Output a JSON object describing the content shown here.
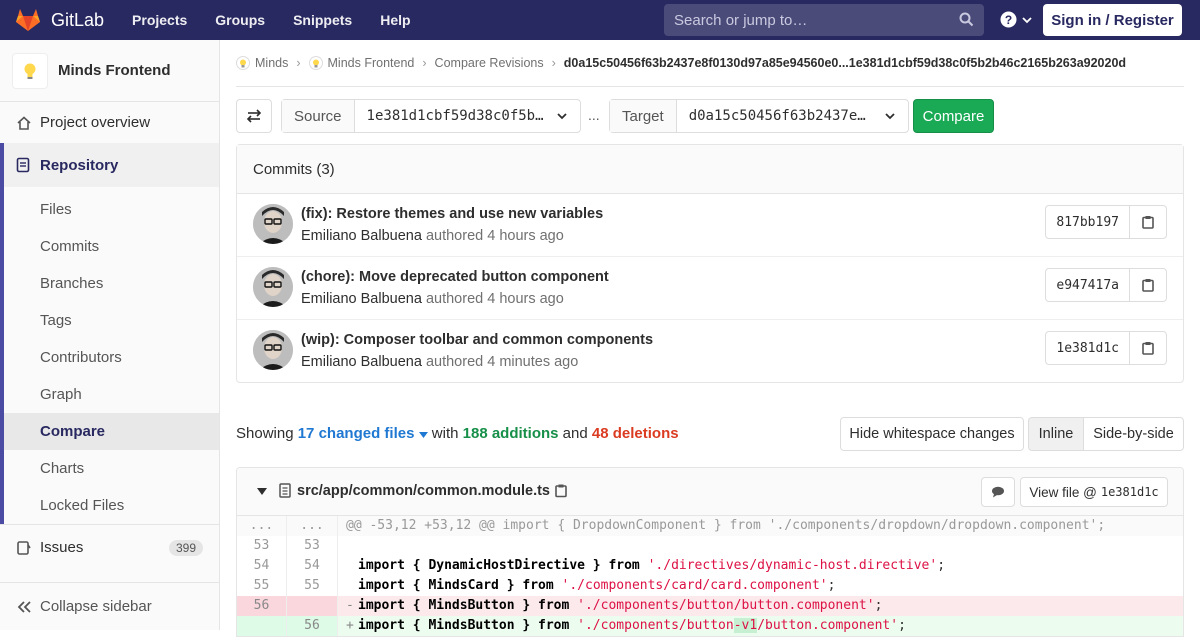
{
  "colors": {
    "nav_bg": "#292961",
    "accent_green": "#1aaa55",
    "link_blue": "#1f78d1",
    "add_green": "#168f48",
    "del_red": "#db3b21"
  },
  "header": {
    "brand": "GitLab",
    "nav": [
      "Projects",
      "Groups",
      "Snippets",
      "Help"
    ],
    "search_placeholder": "Search or jump to…",
    "signin": "Sign in / Register"
  },
  "sidebar": {
    "project_name": "Minds Frontend",
    "overview": "Project overview",
    "repository": "Repository",
    "sub_items": [
      "Files",
      "Commits",
      "Branches",
      "Tags",
      "Contributors",
      "Graph",
      "Compare",
      "Charts",
      "Locked Files"
    ],
    "issues": "Issues",
    "issues_count": "399",
    "collapse": "Collapse sidebar"
  },
  "breadcrumb": {
    "items": [
      "Minds",
      "Minds Frontend",
      "Compare Revisions"
    ],
    "current": "d0a15c50456f63b2437e8f0130d97a85e94560e0...1e381d1cbf59d38c0f5b2b46c2165b263a92020d"
  },
  "compare": {
    "source_label": "Source",
    "source_value": "1e381d1cbf59d38c0f5b…",
    "dots": "...",
    "target_label": "Target",
    "target_value": "d0a15c50456f63b2437e…",
    "button": "Compare"
  },
  "commits": {
    "header": "Commits (3)",
    "items": [
      {
        "title": "(fix): Restore themes and use new variables",
        "author": "Emiliano Balbuena",
        "authored": "authored 4 hours ago",
        "sha": "817bb197"
      },
      {
        "title": "(chore): Move deprecated button component",
        "author": "Emiliano Balbuena",
        "authored": "authored 4 hours ago",
        "sha": "e947417a"
      },
      {
        "title": "(wip): Composer toolbar and common components",
        "author": "Emiliano Balbuena",
        "authored": "authored 4 minutes ago",
        "sha": "1e381d1c"
      }
    ]
  },
  "summary": {
    "showing": "Showing",
    "changed": "17 changed files",
    "with": "with",
    "additions": "188 additions",
    "and": "and",
    "deletions": "48 deletions",
    "whitespace": "Hide whitespace changes",
    "inline": "Inline",
    "side_by_side": "Side-by-side"
  },
  "file": {
    "path": "src/app/common/common.module.ts",
    "view_file": "View file @",
    "view_sha": "1e381d1c",
    "hunk": "@@ -53,12 +53,12 @@ import { DropdownComponent } from './components/dropdown/dropdown.component';",
    "lines": [
      {
        "old": "53",
        "new": "53",
        "text": ""
      },
      {
        "old": "54",
        "new": "54",
        "pre": "import { DynamicHostDirective } ",
        "from": "from",
        "str": "'./directives/dynamic-host.directive'",
        "post": ";"
      },
      {
        "old": "55",
        "new": "55",
        "pre": "import { MindsCard } ",
        "from": "from",
        "str": "'./components/card/card.component'",
        "post": ";"
      },
      {
        "old": "56",
        "new": "",
        "pre": "import { MindsButton } ",
        "from": "from",
        "str": "'./components/button/button.component'",
        "post": ";"
      },
      {
        "old": "",
        "new": "56",
        "pre": "import { MindsButton } ",
        "from": "from",
        "str_a": "'./components/button",
        "str_hl": "-v1",
        "str_b": "/button.component'",
        "post": ";"
      }
    ]
  }
}
